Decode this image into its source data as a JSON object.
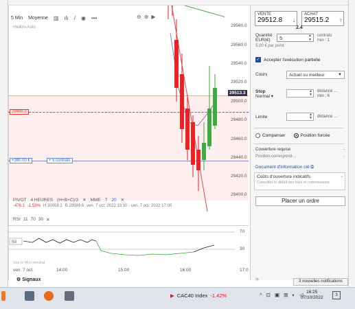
{
  "toolbar": {
    "interval": "5 Min",
    "mode": "Moyenne",
    "instrument": "Heikin-Ashi"
  },
  "price_axis": {
    "labels": [
      "29560.0",
      "29560.0",
      "29540.0",
      "29520.0",
      "29500.0",
      "29480.0",
      "29460.0",
      "29440.0",
      "29420.0",
      "29400.0"
    ],
    "current": "29513.3"
  },
  "order_lines": {
    "stop_price": "29488.0",
    "position_pnl": "+380.00 €",
    "position_contracts": "+ 5 contrats"
  },
  "indicators": {
    "pivot_label": "PIVOT",
    "pivot_tf": "4 HEURES",
    "pivot_calc": "(H+B+C)/3",
    "mme_label": "MME",
    "mme_value": "7",
    "mme_value2": "20",
    "change_abs": "-476.1",
    "change_pct": "-1.59%",
    "high": "H 30059.1",
    "low": "B 29589.6",
    "time_range": "ven. 7 oct. 2022 13:10 - ven. 7 oct. 2022 17:00",
    "rsi_label": "RSI",
    "rsi_p1": "11",
    "rsi_p2": "70",
    "rsi_p3": "30",
    "rsi_70": "70",
    "rsi_30": "30",
    "rsi_left": "50",
    "note": "Voir le Mini résultat"
  },
  "x_axis": {
    "start": "ven. 7 oct.",
    "labels": [
      "14:00",
      "15:00",
      "16:00",
      "17:0"
    ]
  },
  "signals": "Signaux",
  "ticket": {
    "sell_label": "VENTE",
    "sell_price": "29512.8",
    "buy_label": "ACHAT",
    "buy_price": "29515.2",
    "spread": "2.4",
    "quantity_label": "Quantité",
    "quantity_unit": "EUR(€)",
    "quantity_value": "5",
    "contracts_text": "contrats",
    "min_text": "min : 1",
    "per_point": "5,00 € par point",
    "partial_exec": "Accepter l'exécution partielle",
    "cours_label": "Cours",
    "cours_value": "Actuel ou meilleur",
    "stop_label": "Stop",
    "stop_type": "Normal",
    "stop_distance": "distance …",
    "stop_min": "min : 6",
    "limit_label": "Limite",
    "limit_distance": "distance …",
    "compensate": "Compenser",
    "forced_position": "Position forcée",
    "coverage_label": "Couverture requise",
    "coverage_value": "-",
    "position_label": "Position correspond…",
    "position_value": "-",
    "doc_link": "Document d'information clé",
    "costs_title": "Coûts d'ouverture indicatifs",
    "costs_value": "-",
    "costs_sub": "Consulter le détail des frais et commissions",
    "place_order": "Placer un ordre"
  },
  "notifications": "3 nouvelles notifications",
  "taskbar": {
    "ticker_name": "CAC40 Index",
    "ticker_change": "-1.42%",
    "time": "16:25",
    "date": "07/10/2022",
    "notif_count": "3"
  }
}
